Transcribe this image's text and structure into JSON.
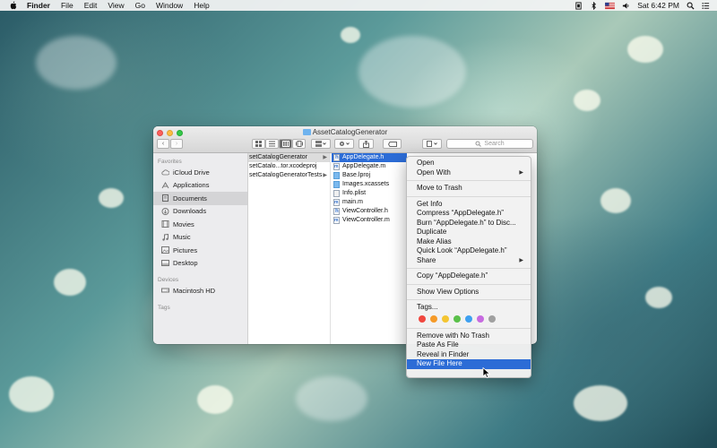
{
  "menubar": {
    "app": "Finder",
    "items": [
      "File",
      "Edit",
      "View",
      "Go",
      "Window",
      "Help"
    ],
    "clock": "Sat 6:42 PM"
  },
  "window": {
    "title": "AssetCatalogGenerator",
    "search_placeholder": "Search"
  },
  "sidebar": {
    "favorites_header": "Favorites",
    "favorites": [
      {
        "label": "iCloud Drive",
        "icon": "cloud-icon"
      },
      {
        "label": "Applications",
        "icon": "applications-icon"
      },
      {
        "label": "Documents",
        "icon": "documents-icon"
      },
      {
        "label": "Downloads",
        "icon": "downloads-icon"
      },
      {
        "label": "Movies",
        "icon": "movies-icon"
      },
      {
        "label": "Music",
        "icon": "music-icon"
      },
      {
        "label": "Pictures",
        "icon": "pictures-icon"
      },
      {
        "label": "Desktop",
        "icon": "desktop-icon"
      }
    ],
    "devices_header": "Devices",
    "devices": [
      {
        "label": "Macintosh HD",
        "icon": "hard-drive-icon"
      }
    ],
    "tags_header": "Tags"
  },
  "column1": [
    {
      "label": "setCatalogGenerator"
    },
    {
      "label": "setCatalo...tor.xcodeproj"
    },
    {
      "label": "setCatalogGeneratorTests"
    }
  ],
  "column2": [
    {
      "label": "AppDelegate.h",
      "type": "h"
    },
    {
      "label": "AppDelegate.m",
      "type": "m"
    },
    {
      "label": "Base.lproj",
      "type": "folder"
    },
    {
      "label": "Images.xcassets",
      "type": "folder"
    },
    {
      "label": "Info.plist",
      "type": "plist"
    },
    {
      "label": "main.m",
      "type": "m"
    },
    {
      "label": "ViewController.h",
      "type": "h"
    },
    {
      "label": "ViewController.m",
      "type": "m"
    }
  ],
  "context_menu": {
    "open": "Open",
    "open_with": "Open With",
    "move_to_trash": "Move to Trash",
    "get_info": "Get Info",
    "compress": "Compress “AppDelegate.h”",
    "burn": "Burn “AppDelegate.h” to Disc...",
    "duplicate": "Duplicate",
    "make_alias": "Make Alias",
    "quick_look": "Quick Look “AppDelegate.h”",
    "share": "Share",
    "copy": "Copy “AppDelegate.h”",
    "show_view_options": "Show View Options",
    "tags": "Tags...",
    "tag_colors": [
      "#f0473f",
      "#f59a28",
      "#f4c531",
      "#5ac04a",
      "#3ea0f0",
      "#c76be0",
      "#a0a0a0"
    ],
    "remove_no_trash": "Remove with No Trash",
    "paste_as_file": "Paste As File",
    "reveal_in_finder": "Reveal in Finder",
    "new_file_here": "New File Here"
  },
  "colors": {
    "selection": "#2c6cd6"
  }
}
